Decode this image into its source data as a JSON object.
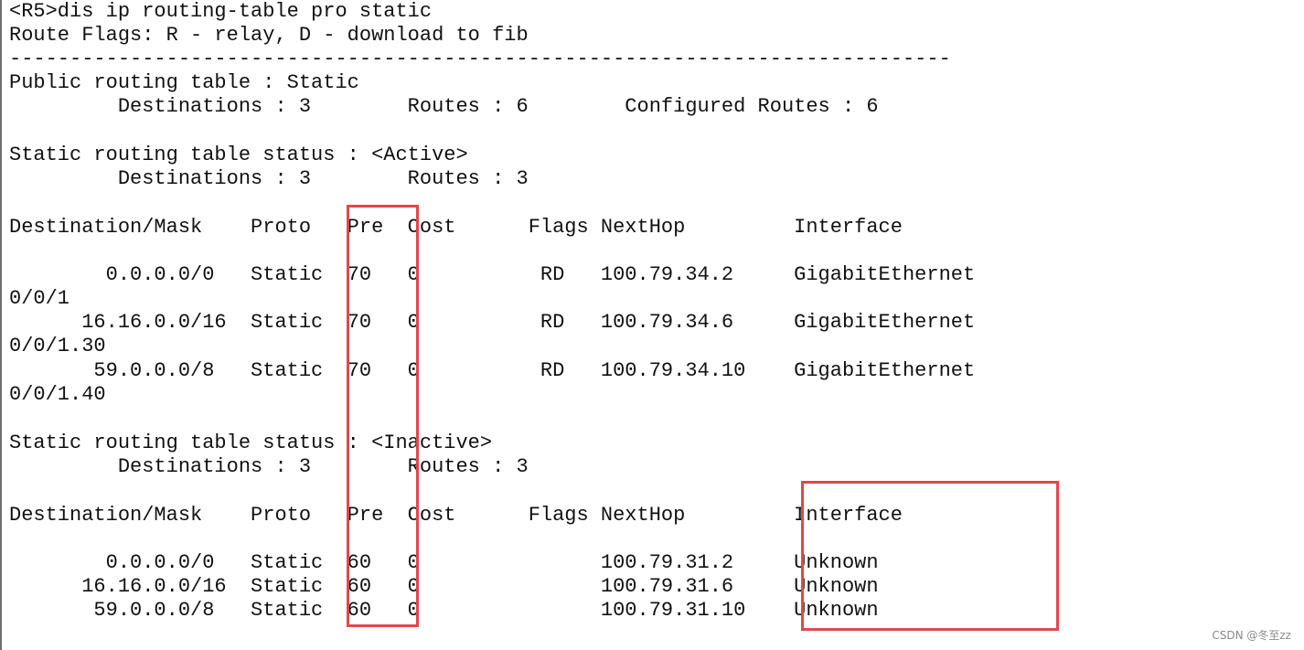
{
  "terminal": {
    "lines": [
      "<R5>dis ip routing-table pro static",
      "Route Flags: R - relay, D - download to fib",
      "------------------------------------------------------------------------------",
      "Public routing table : Static",
      "         Destinations : 3        Routes : 6        Configured Routes : 6",
      "",
      "Static routing table status : <Active>",
      "         Destinations : 3        Routes : 3",
      "",
      "Destination/Mask    Proto   Pre  Cost      Flags NextHop         Interface",
      "",
      "        0.0.0.0/0   Static  70   0          RD   100.79.34.2     GigabitEthernet",
      "0/0/1",
      "      16.16.0.0/16  Static  70   0          RD   100.79.34.6     GigabitEthernet",
      "0/0/1.30",
      "       59.0.0.0/8   Static  70   0          RD   100.79.34.10    GigabitEthernet",
      "0/0/1.40",
      "",
      "Static routing table status : <Inactive>",
      "         Destinations : 3        Routes : 3",
      "",
      "Destination/Mask    Proto   Pre  Cost      Flags NextHop         Interface",
      "",
      "        0.0.0.0/0   Static  60   0               100.79.31.2     Unknown",
      "      16.16.0.0/16  Static  60   0               100.79.31.6     Unknown",
      "       59.0.0.0/8   Static  60   0               100.79.31.10    Unknown"
    ]
  },
  "watermark": "CSDN @冬至zz",
  "colors": {
    "highlight": "#e0484c",
    "text": "#111111",
    "background": "#ffffff"
  }
}
